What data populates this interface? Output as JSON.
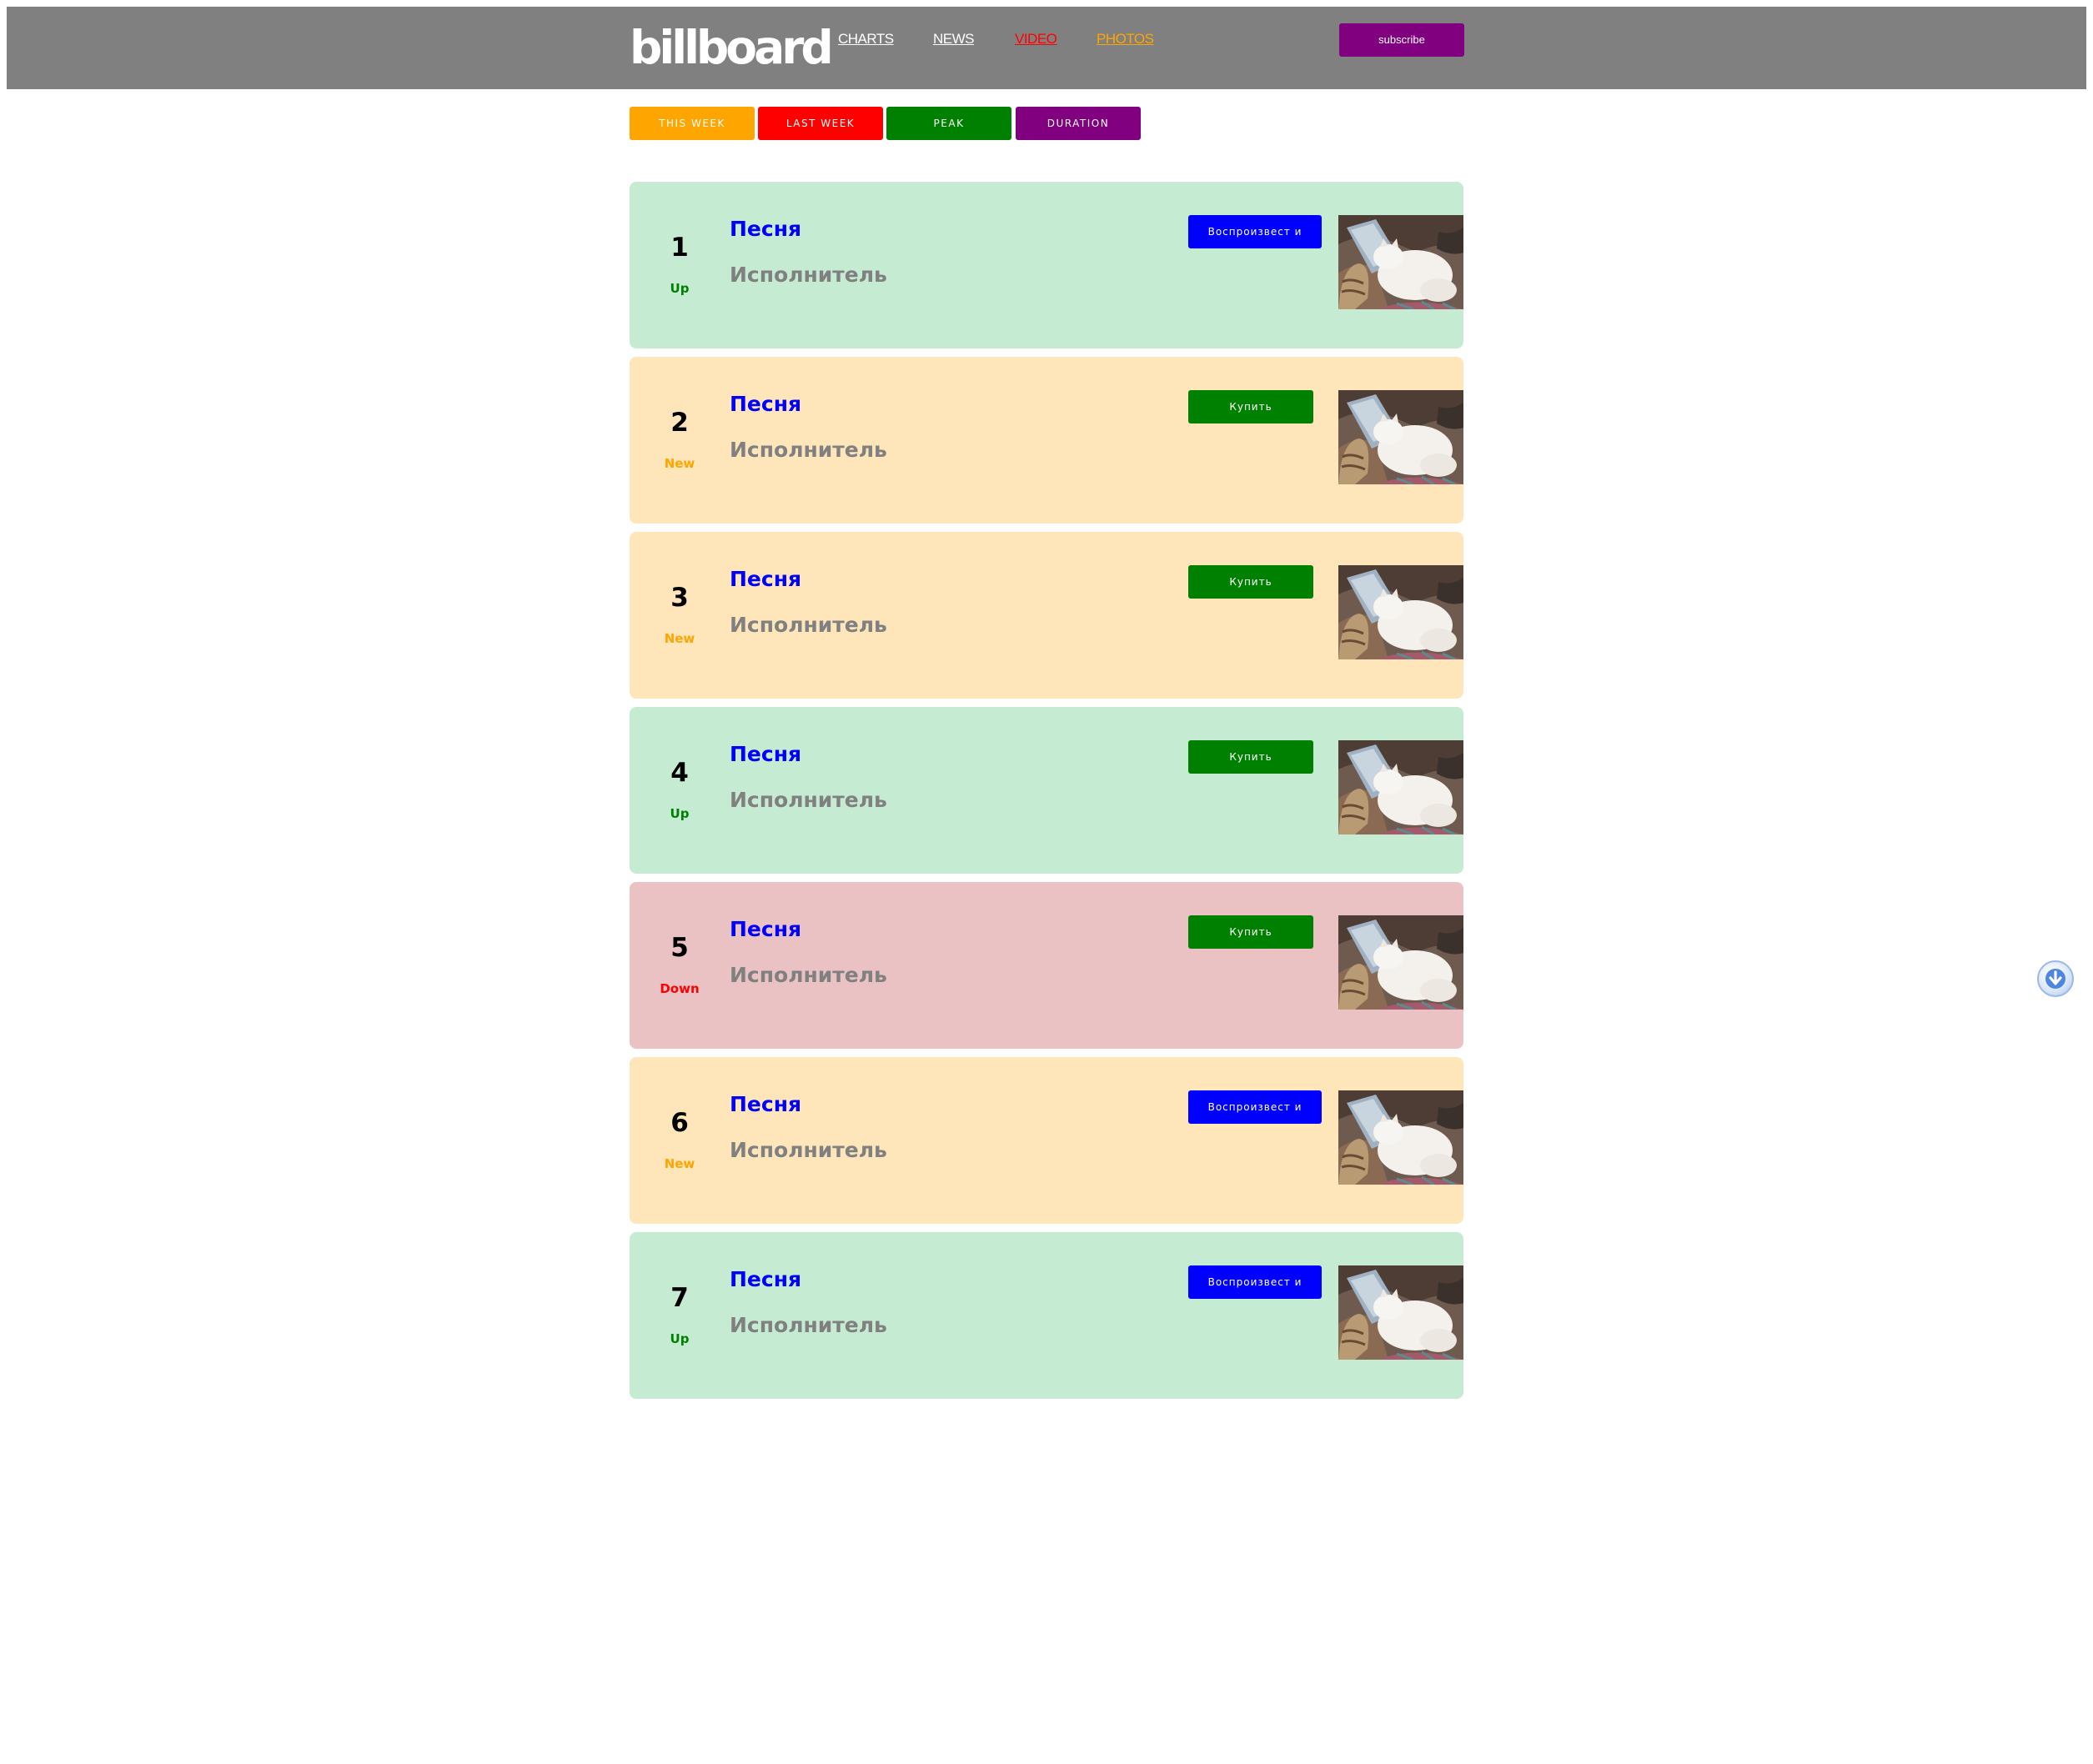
{
  "header": {
    "logo": "billboard",
    "nav": [
      {
        "label": "CHARTS",
        "color": "#ffffff"
      },
      {
        "label": "NEWS",
        "color": "#ffffff"
      },
      {
        "label": "VIDEO",
        "color": "#ff0000"
      },
      {
        "label": "PHOTOS",
        "color": "#ffa500"
      }
    ],
    "subscribe_label": "subscribe",
    "background": "#808080"
  },
  "tabs": [
    {
      "label": "THIS WEEK",
      "color": "#ffa500"
    },
    {
      "label": "LAST WEEK",
      "color": "#ff0000"
    },
    {
      "label": "PEAK",
      "color": "#008000"
    },
    {
      "label": "DURATION",
      "color": "#800080"
    }
  ],
  "chart": {
    "entries": [
      {
        "rank": "1",
        "movement": "Up",
        "song": "Песня",
        "artist": "Исполнитель",
        "action": "Воспроизвест и",
        "action_type": "play",
        "image": "cat-photo"
      },
      {
        "rank": "2",
        "movement": "New",
        "song": "Песня",
        "artist": "Исполнитель",
        "action": "Купить",
        "action_type": "buy",
        "image": "cat-photo"
      },
      {
        "rank": "3",
        "movement": "New",
        "song": "Песня",
        "artist": "Исполнитель",
        "action": "Купить",
        "action_type": "buy",
        "image": "cat-photo"
      },
      {
        "rank": "4",
        "movement": "Up",
        "song": "Песня",
        "artist": "Исполнитель",
        "action": "Купить",
        "action_type": "buy",
        "image": "cat-photo"
      },
      {
        "rank": "5",
        "movement": "Down",
        "song": "Песня",
        "artist": "Исполнитель",
        "action": "Купить",
        "action_type": "buy",
        "image": "cat-photo"
      },
      {
        "rank": "6",
        "movement": "New",
        "song": "Песня",
        "artist": "Исполнитель",
        "action": "Воспроизвест и",
        "action_type": "play",
        "image": "cat-photo"
      },
      {
        "rank": "7",
        "movement": "Up",
        "song": "Песня",
        "artist": "Исполнитель",
        "action": "Воспроизвест и",
        "action_type": "play",
        "image": "cat-photo"
      }
    ]
  },
  "colors": {
    "up_bg": "#c5ecd2",
    "new_bg": "#ffe6ba",
    "down_bg": "#ebc2c4",
    "up_text": "#008000",
    "new_text": "#ffa500",
    "down_text": "#ff0000",
    "play_button": "#0000ff",
    "buy_button": "#008000"
  },
  "scroll_button_icon": "arrow-down-circle-icon"
}
